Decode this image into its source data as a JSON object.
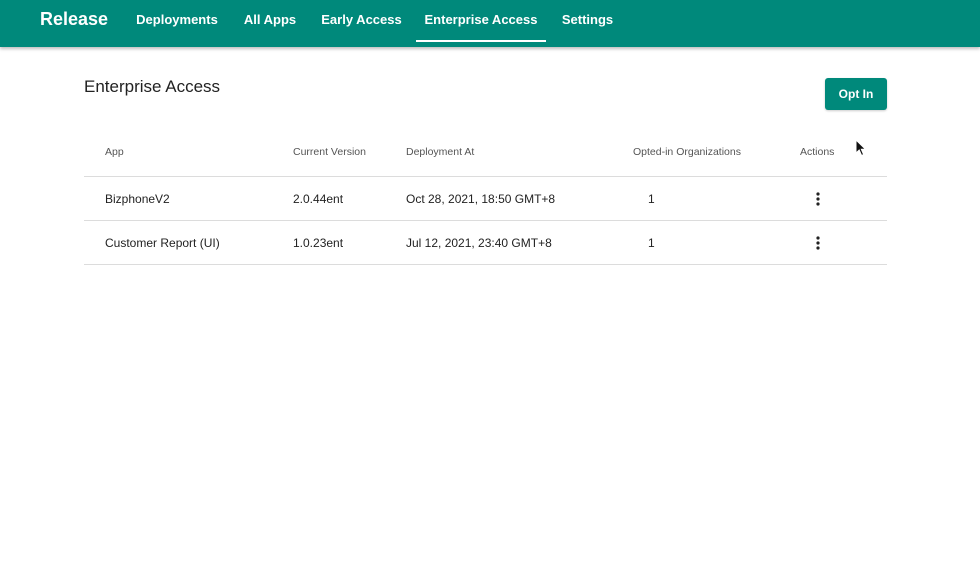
{
  "header": {
    "brand": "Release",
    "nav": [
      {
        "label": "Deployments",
        "active": false
      },
      {
        "label": "All Apps",
        "active": false
      },
      {
        "label": "Early Access",
        "active": false
      },
      {
        "label": "Enterprise Access",
        "active": true
      },
      {
        "label": "Settings",
        "active": false
      }
    ],
    "color": "#00897b"
  },
  "page": {
    "title": "Enterprise Access",
    "opt_in_label": "Opt In"
  },
  "table": {
    "columns": [
      "App",
      "Current Version",
      "Deployment At",
      "Opted-in Organizations",
      "Actions"
    ],
    "rows": [
      {
        "app": "BizphoneV2",
        "version": "2.0.44ent",
        "deployed_at": "Oct 28, 2021, 18:50 GMT+8",
        "orgs": "1",
        "actions_icon": "more-vert-icon"
      },
      {
        "app": "Customer Report (UI)",
        "version": "1.0.23ent",
        "deployed_at": "Jul 12, 2021, 23:40 GMT+8",
        "orgs": "1",
        "actions_icon": "more-vert-icon"
      }
    ]
  }
}
